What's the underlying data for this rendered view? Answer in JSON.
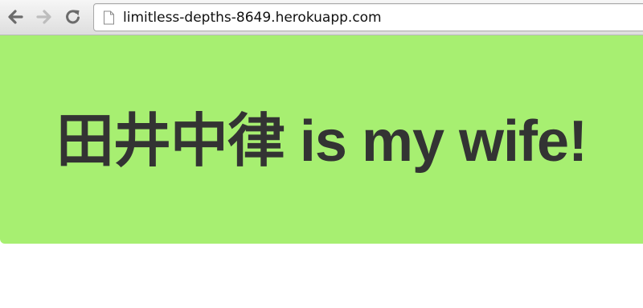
{
  "browser": {
    "url": "limitless-depths-8649.herokuapp.com",
    "icons": {
      "back": "arrow-left-icon",
      "forward": "arrow-right-icon",
      "reload": "reload-icon",
      "page": "document-icon"
    }
  },
  "page": {
    "heading": "田井中律 is my wife!",
    "colors": {
      "hero_background": "#a7ef71",
      "heading_text": "#333333"
    }
  }
}
